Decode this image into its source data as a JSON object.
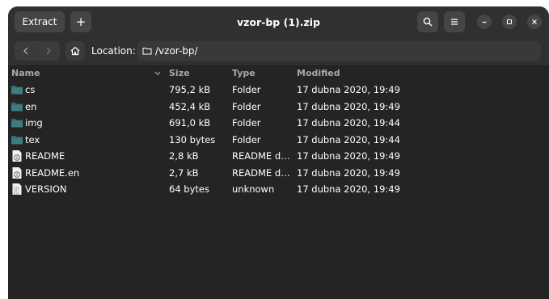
{
  "header": {
    "extract_label": "Extract",
    "new_label": "+",
    "title": "vzor-bp (1).zip"
  },
  "location": {
    "label": "Location:",
    "path": "/vzor-bp/"
  },
  "columns": {
    "name": "Name",
    "size": "Size",
    "type": "Type",
    "modified": "Modified"
  },
  "files": [
    {
      "icon": "folder-icon",
      "name": "cs",
      "size": "795,2 kB",
      "type": "Folder",
      "modified": "17 dubna 2020, 19:49"
    },
    {
      "icon": "folder-icon",
      "name": "en",
      "size": "452,4 kB",
      "type": "Folder",
      "modified": "17 dubna 2020, 19:49"
    },
    {
      "icon": "folder-icon",
      "name": "img",
      "size": "691,0 kB",
      "type": "Folder",
      "modified": "17 dubna 2020, 19:44"
    },
    {
      "icon": "folder-icon",
      "name": "tex",
      "size": "130 bytes",
      "type": "Folder",
      "modified": "17 dubna 2020, 19:44"
    },
    {
      "icon": "info-file-icon",
      "name": "README",
      "size": "2,8 kB",
      "type": "README d…",
      "modified": "17 dubna 2020, 19:49"
    },
    {
      "icon": "info-file-icon",
      "name": "README.en",
      "size": "2,7 kB",
      "type": "README d…",
      "modified": "17 dubna 2020, 19:49"
    },
    {
      "icon": "binary-file-icon",
      "name": "VERSION",
      "size": "64 bytes",
      "type": "unknown",
      "modified": "17 dubna 2020, 19:49"
    }
  ],
  "colors": {
    "window_bg": "#242424",
    "headerbar_bg": "#303030",
    "button_bg": "#454545",
    "folder_teal": "#2f6b6f"
  }
}
